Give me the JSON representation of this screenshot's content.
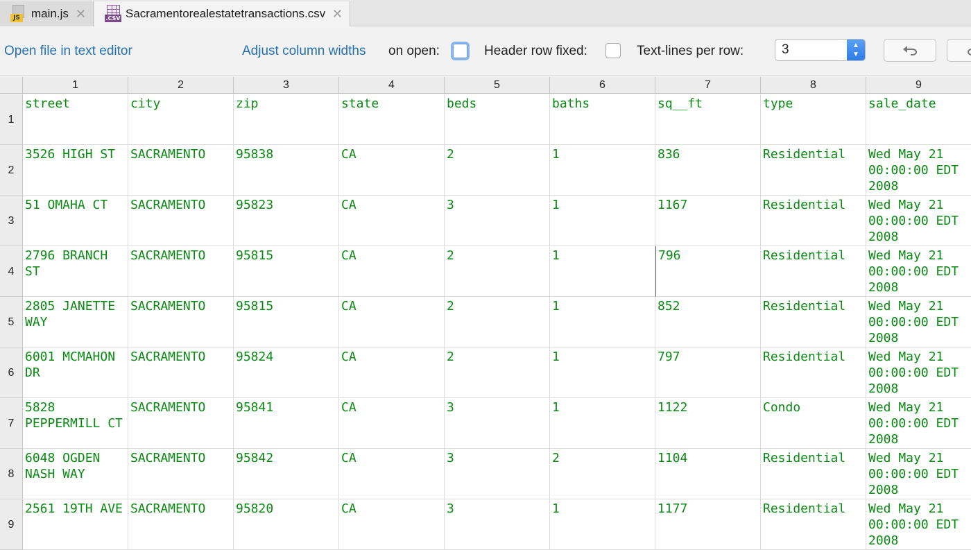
{
  "tabs": [
    {
      "label": "main.js",
      "icon": "js-file-icon",
      "badge": "JS",
      "active": false
    },
    {
      "label": "Sacramentorealestatetransactions.csv",
      "icon": "csv-file-icon",
      "badge": ".CSV",
      "active": true
    }
  ],
  "toolbar": {
    "open_in_editor": "Open file in text editor",
    "adjust_widths_link": "Adjust column widths",
    "on_open": "on open:",
    "header_row_fixed": "Header row fixed:",
    "text_lines_per_row": "Text-lines per row:",
    "lines_value": "3",
    "adjust_checked": false,
    "header_fixed_checked": false
  },
  "table": {
    "column_numbers": [
      "1",
      "2",
      "3",
      "4",
      "5",
      "6",
      "7",
      "8",
      "9"
    ],
    "row_numbers": [
      "1",
      "2",
      "3",
      "4",
      "5",
      "6",
      "7",
      "8",
      "9"
    ],
    "rows": [
      [
        "street",
        "city",
        "zip",
        "state",
        "beds",
        "baths",
        "sq__ft",
        "type",
        "sale_date"
      ],
      [
        "3526 HIGH ST",
        "SACRAMENTO",
        "95838",
        "CA",
        "2",
        "1",
        "836",
        "Residential",
        "Wed May 21 00:00:00 EDT 2008"
      ],
      [
        "51 OMAHA CT",
        "SACRAMENTO",
        "95823",
        "CA",
        "3",
        "1",
        "1167",
        "Residential",
        "Wed May 21 00:00:00 EDT 2008"
      ],
      [
        "2796 BRANCH ST",
        "SACRAMENTO",
        "95815",
        "CA",
        "2",
        "1",
        "796",
        "Residential",
        "Wed May 21 00:00:00 EDT 2008"
      ],
      [
        "2805 JANETTE WAY",
        "SACRAMENTO",
        "95815",
        "CA",
        "2",
        "1",
        "852",
        "Residential",
        "Wed May 21 00:00:00 EDT 2008"
      ],
      [
        "6001 MCMAHON DR",
        "SACRAMENTO",
        "95824",
        "CA",
        "2",
        "1",
        "797",
        "Residential",
        "Wed May 21 00:00:00 EDT 2008"
      ],
      [
        "5828 PEPPERMILL CT",
        "SACRAMENTO",
        "95841",
        "CA",
        "3",
        "1",
        "1122",
        "Condo",
        "Wed May 21 00:00:00 EDT 2008"
      ],
      [
        "6048 OGDEN NASH WAY",
        "SACRAMENTO",
        "95842",
        "CA",
        "3",
        "2",
        "1104",
        "Residential",
        "Wed May 21 00:00:00 EDT 2008"
      ],
      [
        "2561 19TH AVE",
        "SACRAMENTO",
        "95820",
        "CA",
        "3",
        "1",
        "1177",
        "Residential",
        "Wed May 21 00:00:00 EDT 2008"
      ]
    ]
  },
  "colors": {
    "cell_text": "#0a8a12",
    "link": "#2470b3",
    "accent": "#2f7ce8"
  }
}
